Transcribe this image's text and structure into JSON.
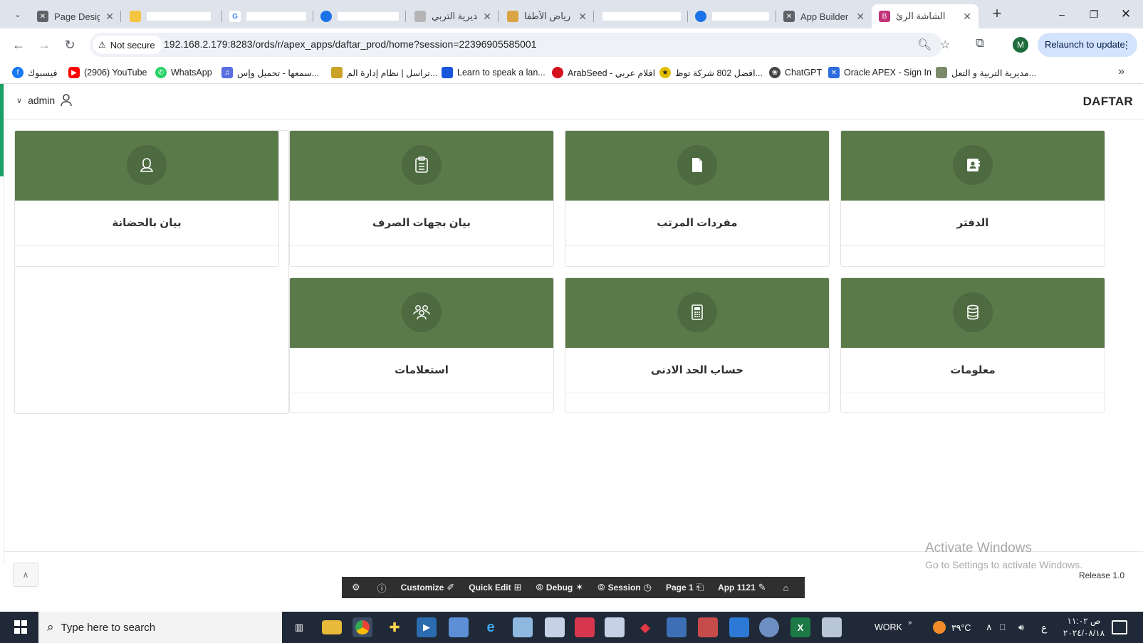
{
  "browser": {
    "tabs": [
      {
        "title": "Page Design",
        "favicon": "apex-icon",
        "active": false
      },
      {
        "title": "",
        "favicon": "emoji-icon",
        "active": false
      },
      {
        "title": "",
        "favicon": "google-icon",
        "active": false
      },
      {
        "title": "",
        "favicon": "blue-icon",
        "active": false
      },
      {
        "title": "مديرية التربي",
        "favicon": "ministry-icon",
        "active": false
      },
      {
        "title": "رياض الأطفا",
        "favicon": "kindergarten-icon",
        "active": false
      },
      {
        "title": "",
        "favicon": "blank-icon",
        "active": false
      },
      {
        "title": "",
        "favicon": "blue-icon",
        "active": false
      },
      {
        "title": "App Builder",
        "favicon": "apex-icon",
        "active": false
      },
      {
        "title": "الشاشة الرئ",
        "favicon": "apex-page-icon",
        "active": true
      }
    ],
    "new_tab_glyph": "+",
    "security_label": "Not secure",
    "url": "192.168.2.179:8283/ords/r/apex_apps/daftar_prod/home?session=22396905585001",
    "profile_initial": "M",
    "relaunch_label": "Relaunch to update",
    "bookmarks": [
      {
        "label": "فيسبوك",
        "icon": "facebook-icon",
        "color": "#1877f2"
      },
      {
        "label": "(2906) YouTube",
        "icon": "youtube-icon",
        "color": "#ff0000"
      },
      {
        "label": "WhatsApp",
        "icon": "whatsapp-icon",
        "color": "#25d366"
      },
      {
        "label": "سمعها - تحميل وإس...",
        "icon": "speaker-icon",
        "color": "#5b6ee1"
      },
      {
        "label": "تراسل | نظام إدارة الم...",
        "icon": "doc-icon",
        "color": "#c9a227"
      },
      {
        "label": "Learn to speak a lan...",
        "icon": "book-icon",
        "color": "#1a56db"
      },
      {
        "label": "ArabSeed - افلام عربي",
        "icon": "arabseed-icon",
        "color": "#d3121e"
      },
      {
        "label": "افضل 802 شركة توظ...",
        "icon": "job-icon",
        "color": "#e2c000"
      },
      {
        "label": "ChatGPT",
        "icon": "chatgpt-icon",
        "color": "#444444"
      },
      {
        "label": "Oracle APEX - Sign In",
        "icon": "apex-icon",
        "color": "#2d6cdf"
      },
      {
        "label": "مديرية التربية و التعل...",
        "icon": "ministry-icon",
        "color": "#7b8a6b"
      }
    ]
  },
  "app": {
    "user": "admin",
    "brand": "DAFTAR",
    "accent_color": "#1aa168",
    "card_color": "#5a7a4a",
    "cards_row1": [
      {
        "label": "الدفتر",
        "icon": "contact-book-icon"
      },
      {
        "label": "مفردات المرتب",
        "icon": "file-icon"
      },
      {
        "label": "بيان بجهات الصرف",
        "icon": "clipboard-icon"
      },
      {
        "label": "بيان بالحضانة",
        "icon": "user-icon"
      }
    ],
    "cards_row2": [
      {
        "label": "معلومات",
        "icon": "database-icon"
      },
      {
        "label": "حساب الحد الادنى",
        "icon": "calculator-icon"
      },
      {
        "label": "استعلامات",
        "icon": "users-icon"
      }
    ],
    "release": "Release 1.0",
    "devbar": {
      "customize": "Customize",
      "quick_edit": "Quick Edit",
      "debug": "Debug",
      "session": "Session",
      "page": "Page 1",
      "app": "App 1121"
    }
  },
  "windows": {
    "activate_title": "Activate Windows",
    "activate_sub": "Go to Settings to activate Windows.",
    "search_placeholder": "Type here to search",
    "tray_label": "WORK",
    "temperature": "٣٩°C",
    "input_lang": "ع",
    "time": "ص ١١:٠٢",
    "date": "٢٠٢٤/٠٨/١٨"
  }
}
